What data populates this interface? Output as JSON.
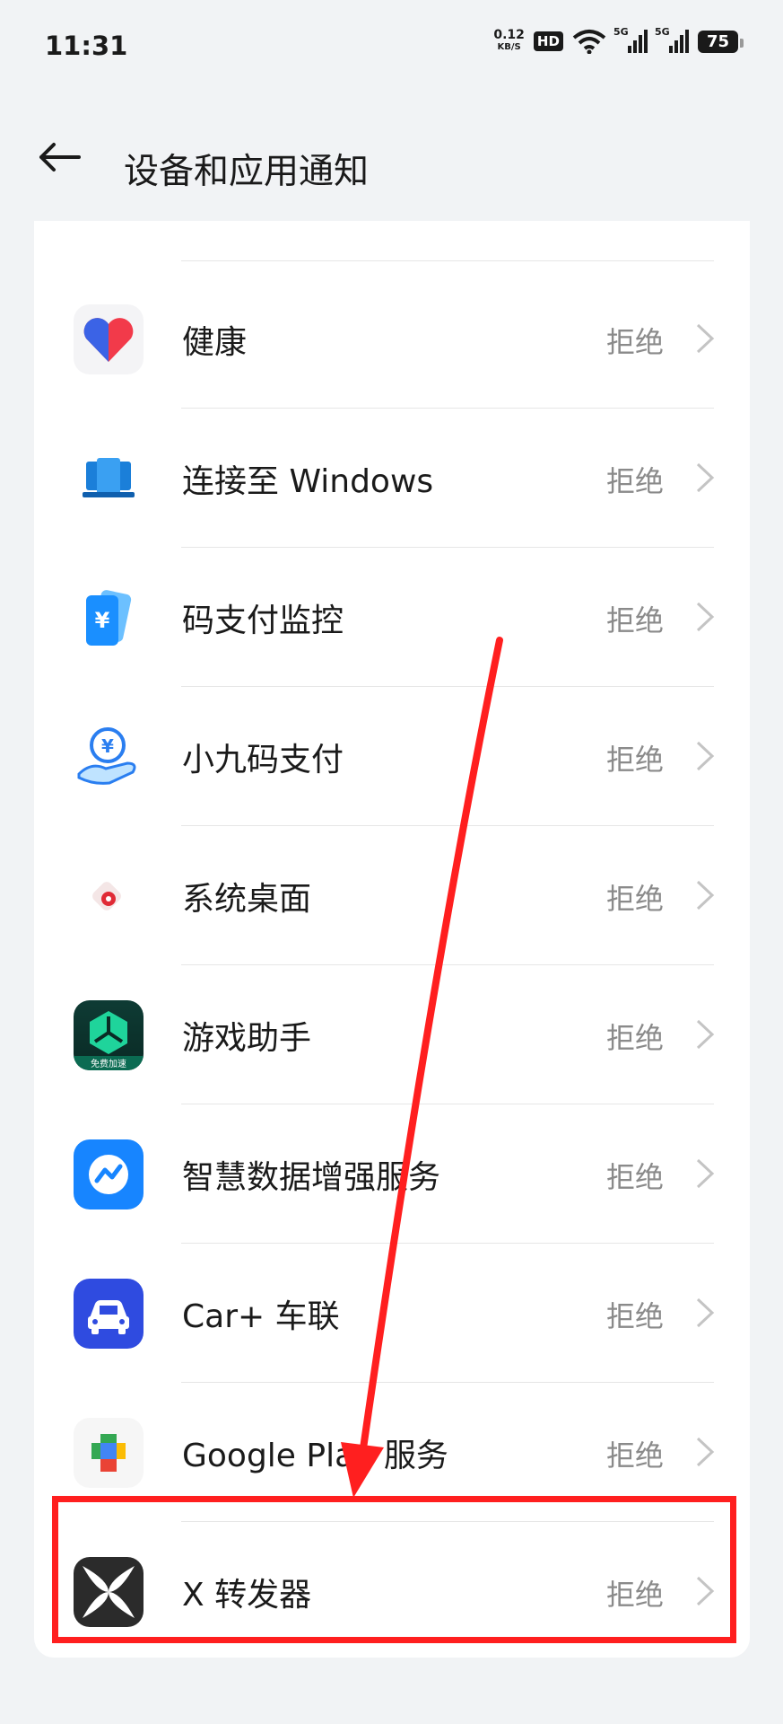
{
  "status_bar": {
    "time": "11:31",
    "net_speed_value": "0.12",
    "net_speed_unit": "KB/S",
    "hd_label": "HD",
    "signal_label_1": "5G",
    "signal_label_2": "5G",
    "battery": "75"
  },
  "header": {
    "title": "设备和应用通知"
  },
  "apps": [
    {
      "label": "健康",
      "status": "拒绝",
      "icon": "health-heart-icon"
    },
    {
      "label": "连接至 Windows",
      "status": "拒绝",
      "icon": "connect-windows-icon"
    },
    {
      "label": "码支付监控",
      "status": "拒绝",
      "icon": "payment-monitor-icon"
    },
    {
      "label": "小九码支付",
      "status": "拒绝",
      "icon": "xiaojiu-pay-icon"
    },
    {
      "label": "系统桌面",
      "status": "拒绝",
      "icon": "system-desktop-icon"
    },
    {
      "label": "游戏助手",
      "status": "拒绝",
      "icon": "game-assistant-icon",
      "icon_badge": "免费加速"
    },
    {
      "label": "智慧数据增强服务",
      "status": "拒绝",
      "icon": "smart-data-icon"
    },
    {
      "label": "Car+ 车联",
      "status": "拒绝",
      "icon": "car-plus-icon"
    },
    {
      "label": "Google Play 服务",
      "status": "拒绝",
      "icon": "google-play-services-icon"
    },
    {
      "label": "X 转发器",
      "status": "拒绝",
      "icon": "x-forwarder-icon"
    }
  ],
  "colors": {
    "highlight": "#ff1f1f",
    "background": "#f1f3f5",
    "card": "#ffffff"
  }
}
